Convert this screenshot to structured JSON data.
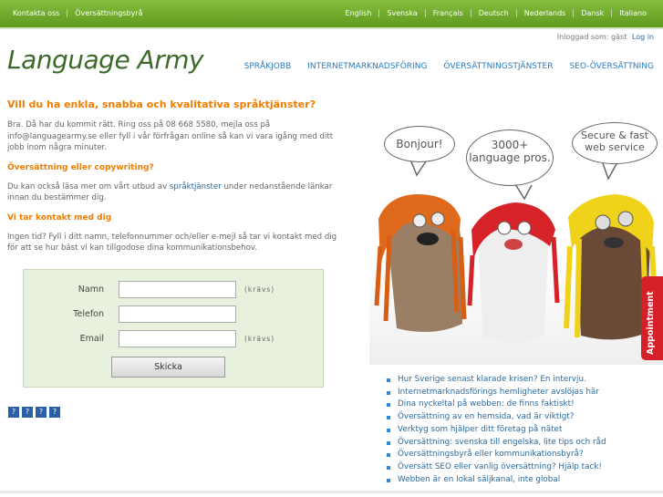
{
  "topbar": {
    "left": [
      "Kontakta oss",
      "Översättningsbyrå"
    ],
    "languages": [
      "English",
      "Svenska",
      "Français",
      "Deutsch",
      "Nederlands",
      "Dansk",
      "Italiano"
    ]
  },
  "login": {
    "status": "Inloggad som: gäst",
    "link": "Log in"
  },
  "logo": "Language Army",
  "nav": [
    "SPRÅKJOBB",
    "INTERNETMARKNADSFÖRING",
    "ÖVERSÄTTNINGSTJÄNSTER",
    "SEO-ÖVERSÄTTNING"
  ],
  "content": {
    "headline": "Vill du ha enkla, snabba och kvalitativa språktjänster?",
    "intro": "Bra. Då har du kommit rätt. Ring oss på 08 668 5580, mejla oss på info@languagearmy.se eller fyll i vår förfrågan online så kan vi vara igång med ditt jobb inom några minuter.",
    "sub1": "Översättning eller copywriting?",
    "para2_a": "Du kan också läsa mer om vårt utbud av ",
    "para2_link": "språktjänster",
    "para2_b": " under nedanstående länkar innan du bestämmer dig.",
    "sub2": "Vi tar kontakt med dig",
    "para3": "Ingen tid? Fyll i ditt namn, telefonnummer och/eller e-mejl så tar vi kontakt med dig för att se hur bäst vi kan tillgodose dina kommunikationsbehov."
  },
  "form": {
    "name_label": "Namn",
    "phone_label": "Telefon",
    "email_label": "Email",
    "required": "(krävs)",
    "submit": "Skicka"
  },
  "hero": {
    "bubble1": "Bonjour!",
    "bubble2": "3000+ language pros.",
    "bubble3": "Secure & fast web service",
    "appointment": "Appointment"
  },
  "articles": [
    "Hur Sverige senast klarade krisen? En intervju.",
    "Internetmarknadsförings hemligheter avslöjas här",
    "Dina nyckeltal på webben: de finns faktiskt!",
    "Översättning av en hemsida, vad är viktigt?",
    "Verktyg som hjälper ditt företag på nätet",
    "Översättning: svenska till engelska, lite tips och råd",
    "Översättningsbyrå eller kommunikationsbyrå?",
    "Översätt SEO eller vanlig översättning? Hjälp tack!",
    "Webben är en lokal säljkanal, inte global"
  ]
}
